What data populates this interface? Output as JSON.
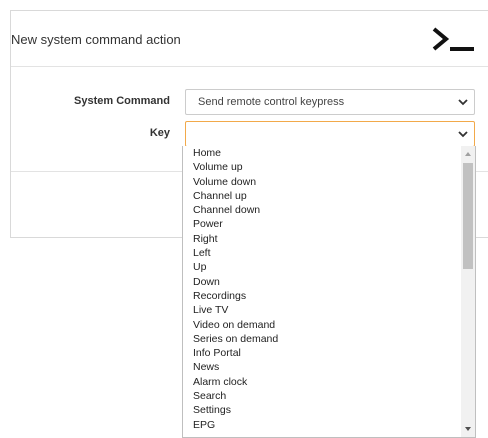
{
  "dialog": {
    "title": "New system command action",
    "header_icon": "terminal-prompt-icon"
  },
  "form": {
    "system_command": {
      "label": "System Command",
      "value": "Send remote control keypress"
    },
    "key": {
      "label": "Key",
      "value": ""
    }
  },
  "dropdown": {
    "options": [
      "Home",
      "Volume up",
      "Volume down",
      "Channel up",
      "Channel down",
      "Power",
      "Right",
      "Left",
      "Up",
      "Down",
      "Recordings",
      "Live TV",
      "Video on demand",
      "Series on demand",
      "Info Portal",
      "News",
      "Alarm clock",
      "Search",
      "Settings",
      "EPG"
    ],
    "scroll_position": 0.0
  },
  "colors": {
    "focus_border": "#f2a94a",
    "border": "#cccccc",
    "scrollbar_thumb": "#c1c1c1"
  }
}
